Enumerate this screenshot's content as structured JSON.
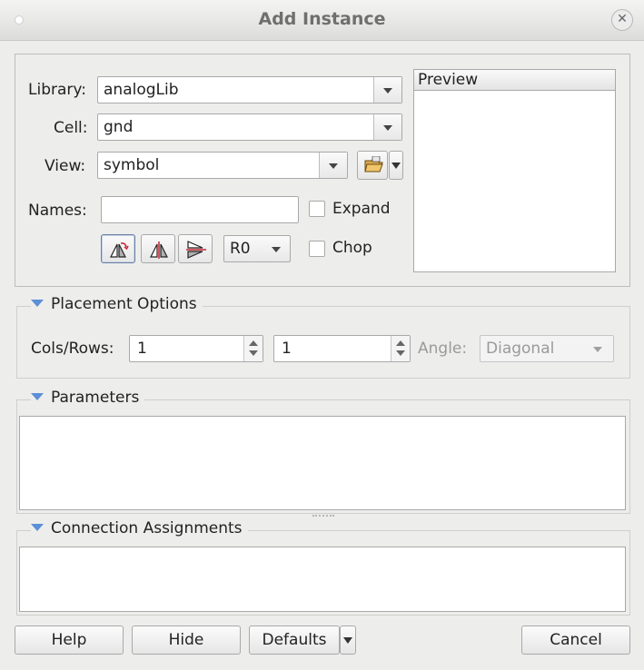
{
  "window": {
    "title": "Add Instance"
  },
  "form": {
    "library_label": "Library:",
    "library_value": "analogLib",
    "cell_label": "Cell:",
    "cell_value": "gnd",
    "view_label": "View:",
    "view_value": "symbol",
    "names_label": "Names:",
    "names_value": "",
    "expand_label": "Expand",
    "expand_checked": false,
    "chop_label": "Chop",
    "chop_checked": false,
    "rotation_value": "R0",
    "preview_label": "Preview"
  },
  "placement": {
    "header": "Placement Options",
    "colsrows_label": "Cols/Rows:",
    "cols_value": "1",
    "rows_value": "1",
    "angle_label": "Angle:",
    "angle_value": "Diagonal"
  },
  "parameters": {
    "header": "Parameters"
  },
  "connections": {
    "header": "Connection Assignments"
  },
  "buttons": {
    "help": "Help",
    "hide": "Hide",
    "defaults": "Defaults",
    "cancel": "Cancel"
  },
  "icons": [
    "rotate-icon",
    "mirror-vertical-icon",
    "mirror-horizontal-icon",
    "browse-folder-icon",
    "close-icon"
  ]
}
